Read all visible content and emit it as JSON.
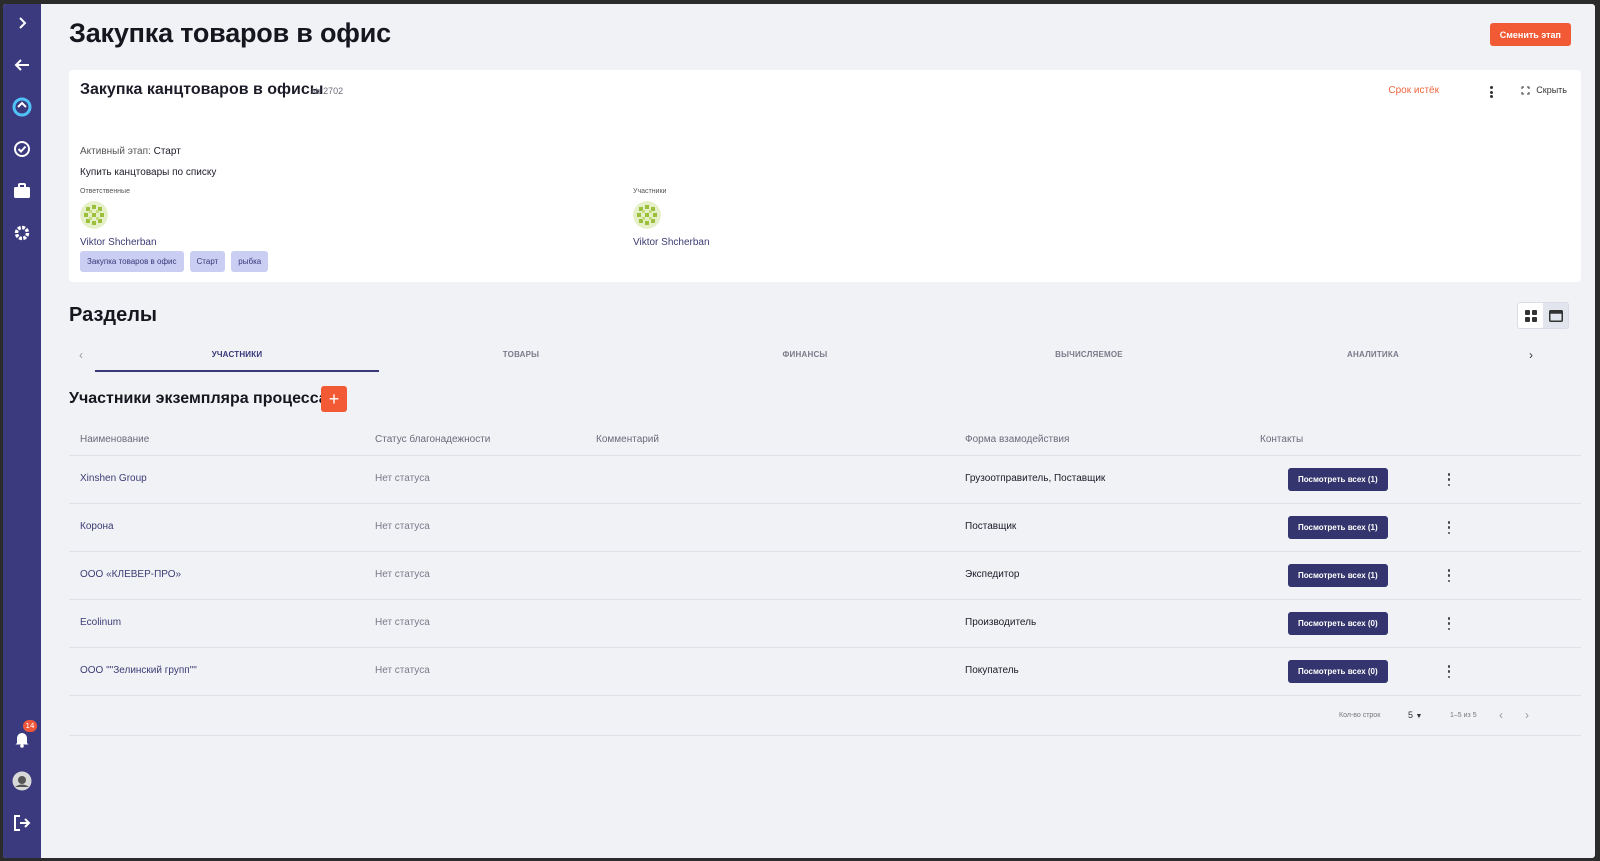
{
  "page": {
    "title": "Закупка товаров в офис",
    "change_stage_label": "Сменить этап"
  },
  "sidebar": {
    "icons": [
      "chevron-right-icon",
      "arrow-left-icon",
      "app-logo-icon",
      "check-circle-icon",
      "briefcase-icon",
      "gear-icon"
    ],
    "notifications_count": "14"
  },
  "card": {
    "title": "Закупка канцтоваров в офисы",
    "number": "№ 2702",
    "deadline": "Срок истёк",
    "hide_label": "Скрыть",
    "active_stage_label": "Активный этап:",
    "active_stage_value": "Старт",
    "description": "Купить канцтовары по списку",
    "responsible_label": "Ответственные",
    "responsible_name": "Viktor Shcherban",
    "participants_label": "Участники",
    "participant_name": "Viktor Shcherban",
    "tags": [
      "Закупка товаров в офис",
      "Старт",
      "рыбка"
    ]
  },
  "sections": {
    "title": "Разделы",
    "tabs": [
      "УЧАСТНИКИ",
      "ТОВАРЫ",
      "ФИНАНСЫ",
      "ВЫЧИСЛЯЕМОЕ",
      "АНАЛИТИКА"
    ],
    "active_tab": "УЧАСТНИКИ"
  },
  "participants": {
    "title": "Участники экземпляра процесса",
    "add_label": "+",
    "columns": [
      "Наименование",
      "Статус благонадежности",
      "Комментарий",
      "Форма взамодействия",
      "Контакты"
    ],
    "rows": [
      {
        "name": "Xinshen Group",
        "status": "Нет статуса",
        "comment": "",
        "form": "Грузоотправитель, Поставщик",
        "contacts": "Посмотреть всех (1)"
      },
      {
        "name": "Корона",
        "status": "Нет статуса",
        "comment": "",
        "form": "Поставщик",
        "contacts": "Посмотреть всех (1)"
      },
      {
        "name": "ООО «КЛЕВЕР-ПРО»",
        "status": "Нет статуса",
        "comment": "",
        "form": "Экспедитор",
        "contacts": "Посмотреть всех (1)"
      },
      {
        "name": "Ecolinum",
        "status": "Нет статуса",
        "comment": "",
        "form": "Производитель",
        "contacts": "Посмотреть всех (0)"
      },
      {
        "name": "ООО \"\"Зелинский групп\"\"",
        "status": "Нет статуса",
        "comment": "",
        "form": "Покупатель",
        "contacts": "Посмотреть всех (0)"
      }
    ]
  },
  "pagination": {
    "rows_label": "Кол-во строк",
    "rows_value": "5",
    "range": "1–5 из 5"
  },
  "colors": {
    "sidebar": "#3b3a7e",
    "accent": "#f15a34",
    "primary": "#34346e",
    "chip": "#cbcef3",
    "background": "#f1f2f6"
  }
}
